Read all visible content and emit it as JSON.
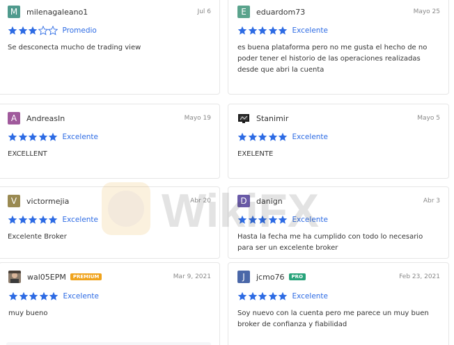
{
  "reviews": [
    {
      "user": "milenagaleano1",
      "initial": "M",
      "avatar_color": "#4f9a8d",
      "date": "Jul 6",
      "stars": 3,
      "rating_label": "Promedio",
      "text": "Se desconecta mucho de trading view"
    },
    {
      "user": "eduardom73",
      "initial": "E",
      "avatar_color": "#5aa38c",
      "date": "Mayo 25",
      "stars": 5,
      "rating_label": "Excelente",
      "text": "es buena plataforma pero no me gusta el hecho de no poder tener el historio de las operaciones realizadas desde que abri la cuenta"
    },
    {
      "user": "AndreasIn",
      "initial": "A",
      "avatar_color": "#a05a9c",
      "date": "Mayo 19",
      "stars": 5,
      "rating_label": "Excelente",
      "text": "EXCELLENT"
    },
    {
      "user": "Stanimir",
      "initial": "",
      "avatar_color": "#ffffff",
      "date": "Mayo 5",
      "stars": 5,
      "rating_label": "Excelente",
      "text": "EXELENTE"
    },
    {
      "user": "victormejia",
      "initial": "V",
      "avatar_color": "#9a8a52",
      "date": "Abr 20",
      "stars": 5,
      "rating_label": "Excelente",
      "text": "Excelente Broker"
    },
    {
      "user": "danign",
      "initial": "D",
      "avatar_color": "#6a5aa8",
      "date": "Abr 3",
      "stars": 5,
      "rating_label": "Excelente",
      "text": "Hasta la fecha me ha cumplido con todo lo necesario para ser un excelente broker"
    },
    {
      "user": "wal05EPM",
      "initial": "",
      "avatar_color": "#ffffff",
      "badge": "PREMIUM",
      "badge_color": "#f0a31c",
      "date": "Mar 9, 2021",
      "stars": 5,
      "rating_label": "Excelente",
      "text": "muy bueno"
    },
    {
      "user": "jcmo76",
      "initial": "J",
      "avatar_color": "#4a67a8",
      "badge": "PRO",
      "badge_color": "#27a37a",
      "date": "Feb 23, 2021",
      "stars": 5,
      "rating_label": "Excelente",
      "text": "Soy nuevo con la cuenta pero me parece un muy buen broker de confianza y fiabilidad"
    }
  ],
  "colors": {
    "star_filled": "#2d6be4",
    "star_empty": "#2d6be4"
  },
  "watermark": {
    "text": "WikiFX"
  }
}
